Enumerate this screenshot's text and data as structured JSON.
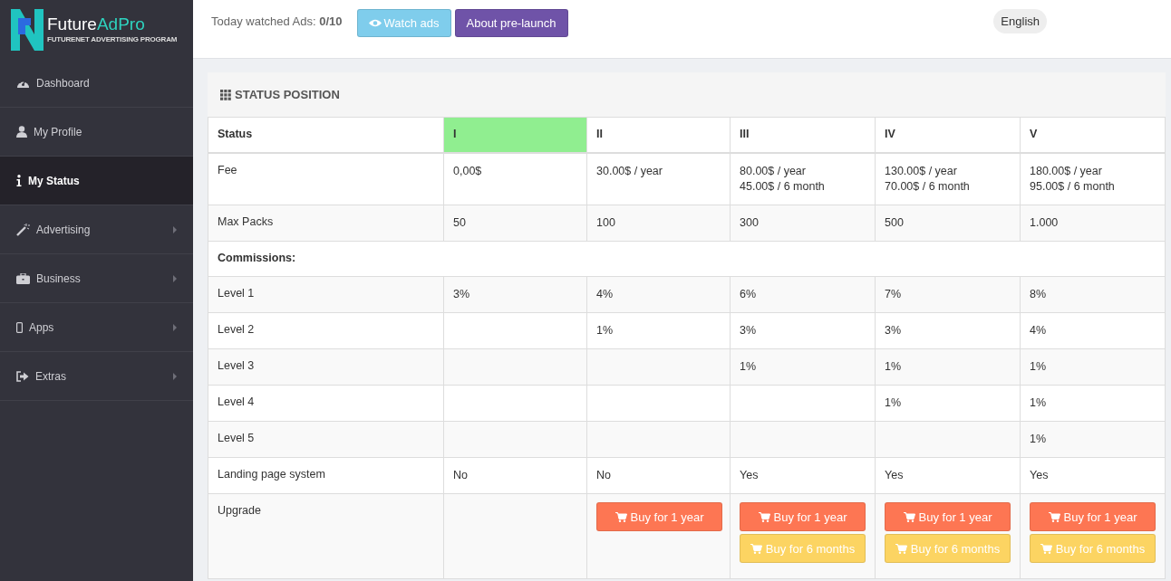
{
  "logo": {
    "name_start": "Future",
    "name_end": "AdPro",
    "tagline": "FUTURENET ADVERTISING PROGRAM"
  },
  "sidebar": {
    "items": [
      {
        "label": "Dashboard",
        "selected": false,
        "submenu": false
      },
      {
        "label": "My Profile",
        "selected": false,
        "submenu": false
      },
      {
        "label": "My Status",
        "selected": true,
        "submenu": false
      },
      {
        "label": "Advertising",
        "selected": false,
        "submenu": true
      },
      {
        "label": "Business",
        "selected": false,
        "submenu": true
      },
      {
        "label": "Apps",
        "selected": false,
        "submenu": true
      },
      {
        "label": "Extras",
        "selected": false,
        "submenu": true
      }
    ]
  },
  "topbar": {
    "watched": "Today watched Ads: **0/10**",
    "buttons": [
      {
        "label": "Watch ads",
        "kind": "info"
      },
      {
        "label": "About pre-launch",
        "kind": "purple"
      }
    ],
    "language": "English"
  },
  "panel": {
    "title": "STATUS POSITION",
    "table": {
      "columns": [
        {
          "label": "Status",
          "highlighted": false
        },
        {
          "label": "I",
          "highlighted": true
        },
        {
          "label": "II",
          "highlighted": false
        },
        {
          "label": "III",
          "highlighted": false
        },
        {
          "label": "IV",
          "highlighted": false
        },
        {
          "label": "V",
          "highlighted": false
        }
      ],
      "rows": [
        {
          "kind": "data",
          "label": "Fee",
          "cells": [
            [
              "0,00$"
            ],
            [
              "30.00$ / year"
            ],
            [
              "80.00$ / year",
              "45.00$ / 6 month"
            ],
            [
              "130.00$ / year",
              "70.00$ / 6 month"
            ],
            [
              "180.00$ / year",
              "95.00$ / 6 month"
            ]
          ]
        },
        {
          "kind": "data",
          "label": "Max Packs",
          "cells": [
            [
              "50"
            ],
            [
              "100"
            ],
            [
              "300"
            ],
            [
              "500"
            ],
            [
              "1.000"
            ]
          ]
        },
        {
          "kind": "section",
          "label": "Commissions:"
        },
        {
          "kind": "data",
          "label": "Level 1",
          "cells": [
            [
              "3%"
            ],
            [
              "4%"
            ],
            [
              "6%"
            ],
            [
              "7%"
            ],
            [
              "8%"
            ]
          ]
        },
        {
          "kind": "data",
          "label": "Level 2",
          "cells": [
            null,
            [
              "1%"
            ],
            [
              "3%"
            ],
            [
              "3%"
            ],
            [
              "4%"
            ]
          ]
        },
        {
          "kind": "data",
          "label": "Level 3",
          "cells": [
            null,
            null,
            [
              "1%"
            ],
            [
              "1%"
            ],
            [
              "1%"
            ]
          ]
        },
        {
          "kind": "data",
          "label": "Level 4",
          "cells": [
            null,
            null,
            null,
            [
              "1%"
            ],
            [
              "1%"
            ]
          ]
        },
        {
          "kind": "data",
          "label": "Level 5",
          "cells": [
            null,
            null,
            null,
            null,
            [
              "1%"
            ]
          ]
        },
        {
          "kind": "data",
          "label": "Landing page system",
          "cells": [
            [
              "No"
            ],
            [
              "No"
            ],
            [
              "Yes"
            ],
            [
              "Yes"
            ],
            [
              "Yes"
            ]
          ]
        },
        {
          "kind": "upgrade",
          "label": "Upgrade",
          "cells": [
            null,
            [
              {
                "label": "Buy for 1 year",
                "kind": "year"
              }
            ],
            [
              {
                "label": "Buy for 1 year",
                "kind": "year"
              },
              {
                "label": "Buy for 6 months",
                "kind": "half"
              }
            ],
            [
              {
                "label": "Buy for 1 year",
                "kind": "year"
              },
              {
                "label": "Buy for 6 months",
                "kind": "half"
              }
            ],
            [
              {
                "label": "Buy for 1 year",
                "kind": "year"
              },
              {
                "label": "Buy for 6 months",
                "kind": "half"
              }
            ]
          ]
        }
      ]
    }
  }
}
